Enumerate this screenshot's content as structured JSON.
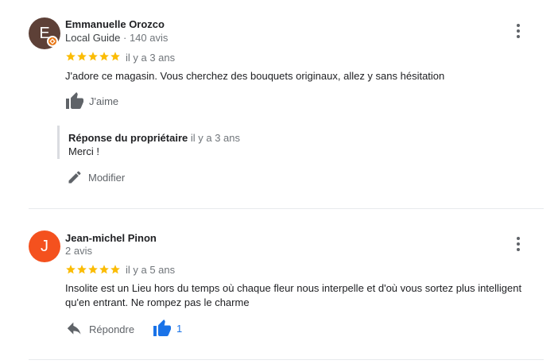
{
  "reviews": [
    {
      "avatar_letter": "E",
      "avatar_color": "#5d4037",
      "name": "Emmanuelle Orozco",
      "guide_label": "Local Guide",
      "separator": " · ",
      "review_count": "140 avis",
      "rating": 5,
      "date": "il y a 3 ans",
      "text": "J'adore ce magasin.  Vous cherchez des bouquets originaux, allez y sans hésitation",
      "like_label": "J'aime",
      "owner_response": {
        "label": "Réponse du propriétaire",
        "date": "il y a 3 ans",
        "text": "Merci !"
      },
      "edit_label": "Modifier"
    },
    {
      "avatar_letter": "J",
      "avatar_color": "#f4511e",
      "name": "Jean-michel Pinon",
      "review_count": "2 avis",
      "rating": 5,
      "date": "il y a 5 ans",
      "text_line1": "Insolite est un Lieu hors du temps où chaque fleur nous interpelle et d'où vous sortez plus intelligent",
      "text_line2": "qu'en entrant. Ne rompez pas le charme",
      "reply_label": "Répondre",
      "like_count": "1"
    }
  ],
  "colors": {
    "star": "#fbbc04",
    "like_active": "#1a73e8",
    "icon_gray": "#5f6368"
  }
}
